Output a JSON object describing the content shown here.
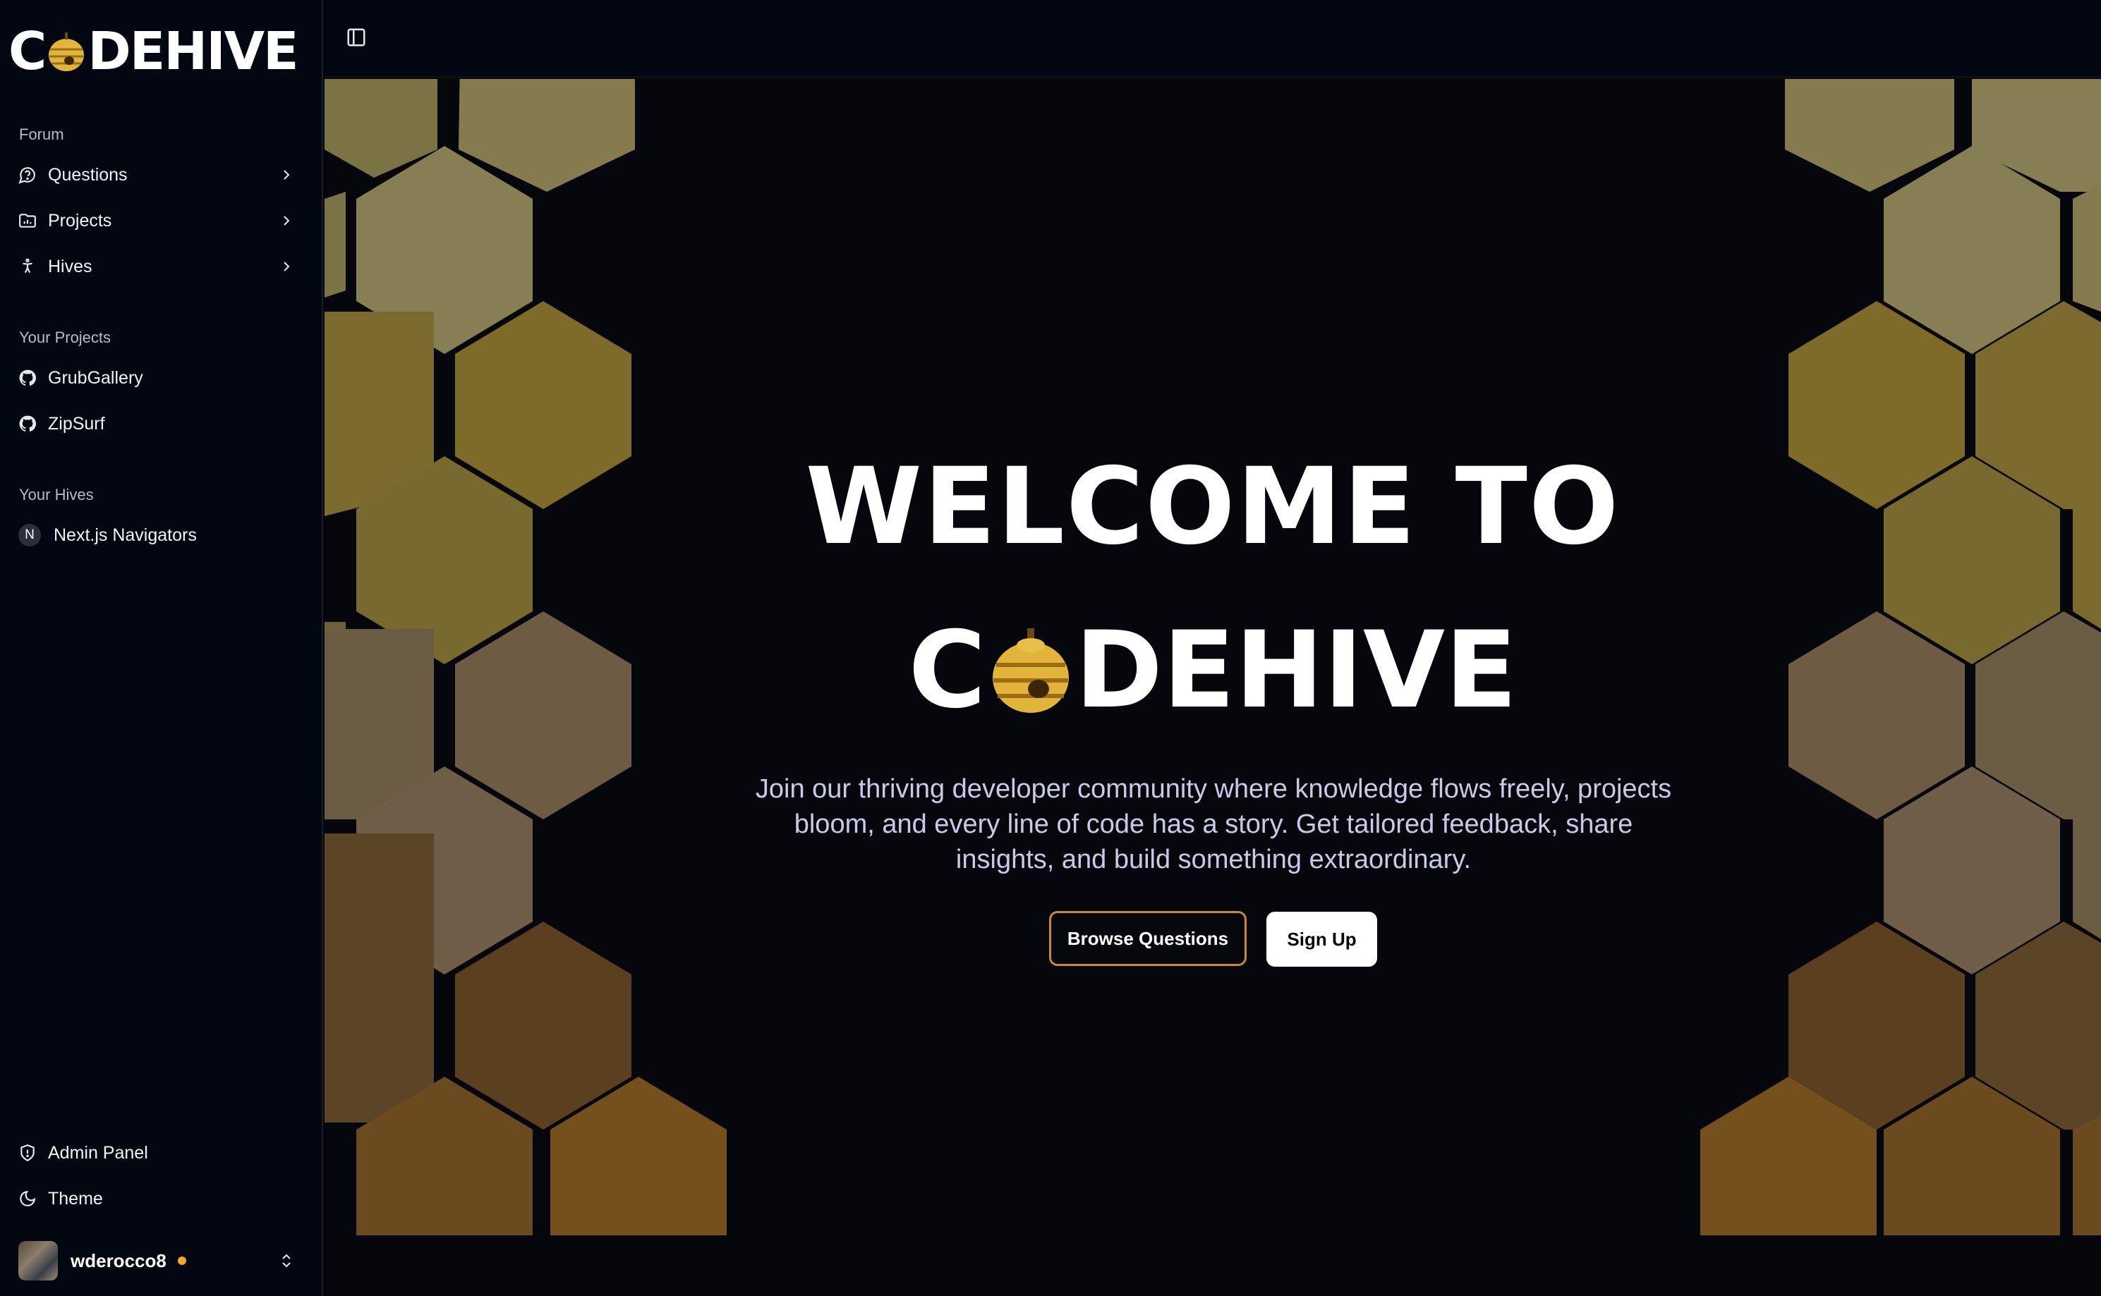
{
  "app": {
    "logo_left": "C",
    "logo_right": "DEHIVE"
  },
  "sidebar": {
    "forum_label": "Forum",
    "forum_items": [
      {
        "label": "Questions",
        "icon": "message-question-icon"
      },
      {
        "label": "Projects",
        "icon": "folder-chart-icon"
      },
      {
        "label": "Hives",
        "icon": "person-standing-icon"
      }
    ],
    "projects_label": "Your Projects",
    "projects": [
      {
        "label": "GrubGallery",
        "icon": "github-icon"
      },
      {
        "label": "ZipSurf",
        "icon": "github-icon"
      }
    ],
    "hives_label": "Your Hives",
    "hives": [
      {
        "label": "Next.js Navigators",
        "badge": "N"
      }
    ],
    "bottom_items": [
      {
        "label": "Admin Panel",
        "icon": "shield-icon"
      },
      {
        "label": "Theme",
        "icon": "moon-icon"
      }
    ],
    "user": {
      "name": "wderocco8",
      "status_color": "#f4a52b"
    }
  },
  "hero": {
    "title_line1": "WELCOME TO",
    "title_line2_left": "C",
    "title_line2_right": "DEHIVE",
    "description": "Join our thriving developer community where knowledge flows freely, projects bloom, and every line of code has a story. Get tailored feedback, share insights, and build something extraordinary.",
    "browse_button": "Browse Questions",
    "signup_button": "Sign Up"
  },
  "colors": {
    "accent": "#c98a2c",
    "background": "#06070c",
    "sidebar": "#030712"
  }
}
